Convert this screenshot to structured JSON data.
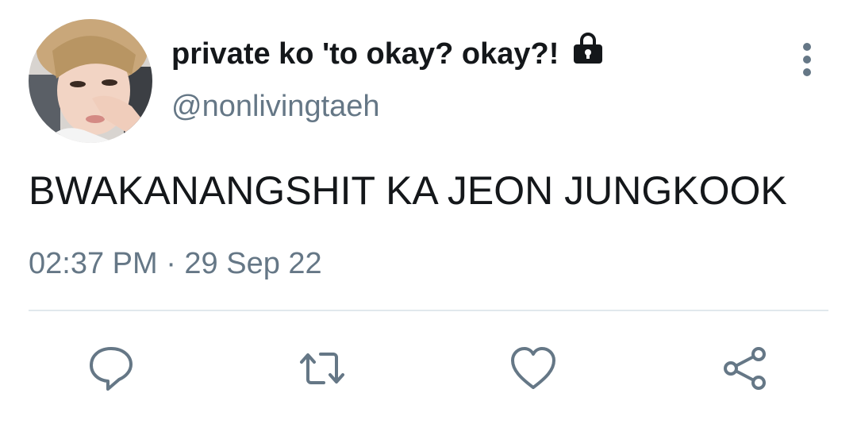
{
  "tweet": {
    "display_name": "private ko 'to okay? okay?!",
    "handle": "@nonlivingtaeh",
    "text": "BWAKANANGSHIT KA JEON JUNGKOOK",
    "timestamp": "02:37 PM · 29 Sep 22",
    "protected": true
  },
  "icons": {
    "lock": "lock-icon",
    "more": "more-vertical-icon",
    "reply": "reply-icon",
    "retweet": "retweet-icon",
    "like": "heart-icon",
    "share": "share-icon"
  },
  "colors": {
    "primary_text": "#14171a",
    "secondary_text": "#657786",
    "icon": "#657786",
    "divider": "#e1e8ed"
  }
}
